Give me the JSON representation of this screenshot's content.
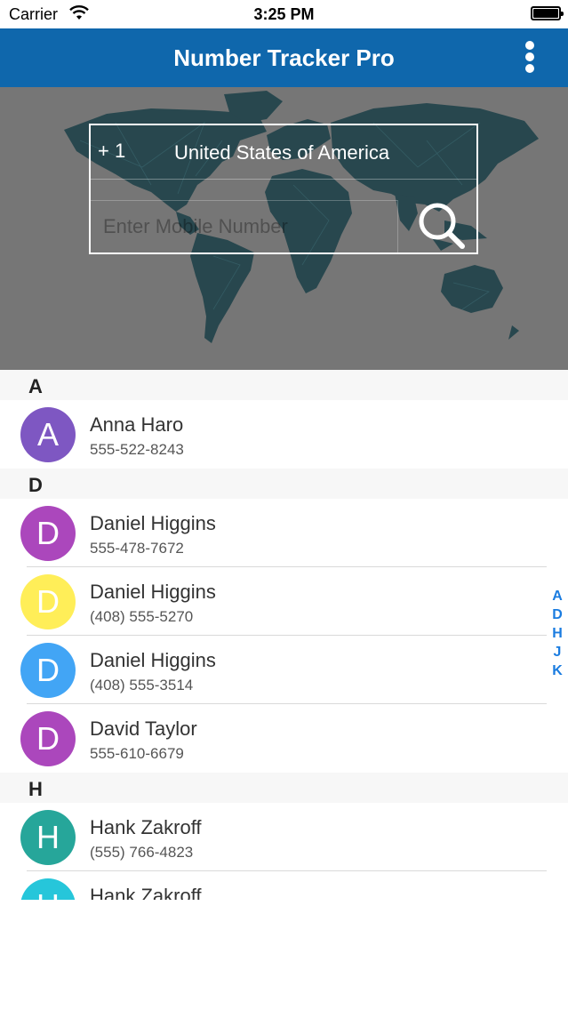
{
  "status_bar": {
    "carrier": "Carrier",
    "time": "3:25 PM",
    "wifi_icon": "wifi-icon",
    "battery_icon": "battery-icon"
  },
  "nav": {
    "title": "Number Tracker Pro",
    "menu_icon": "more-vertical-icon",
    "color": "#0f67ac"
  },
  "search": {
    "country_code": "+ 1",
    "country_name": "United States of America",
    "mobile_placeholder": "Enter Mobile Number",
    "search_icon": "search-icon"
  },
  "sections": [
    {
      "letter": "A",
      "contacts": [
        {
          "initial": "A",
          "name": "Anna Haro",
          "phone": "555-522-8243",
          "color": "#7e57c2"
        }
      ]
    },
    {
      "letter": "D",
      "contacts": [
        {
          "initial": "D",
          "name": "Daniel Higgins",
          "phone": "555-478-7672",
          "color": "#ab47bc"
        },
        {
          "initial": "D",
          "name": "Daniel Higgins",
          "phone": "(408) 555-5270",
          "color": "#ffee58"
        },
        {
          "initial": "D",
          "name": "Daniel Higgins",
          "phone": "(408) 555-3514",
          "color": "#42a5f5"
        },
        {
          "initial": "D",
          "name": "David Taylor",
          "phone": "555-610-6679",
          "color": "#ab47bc"
        }
      ]
    },
    {
      "letter": "H",
      "contacts": [
        {
          "initial": "H",
          "name": "Hank Zakroff",
          "phone": "(555) 766-4823",
          "color": "#26a69a"
        },
        {
          "initial": "H",
          "name": "Hank Zakroff",
          "phone": "",
          "color": "#26c6da"
        }
      ]
    }
  ],
  "index": [
    "A",
    "D",
    "H",
    "J",
    "K"
  ]
}
